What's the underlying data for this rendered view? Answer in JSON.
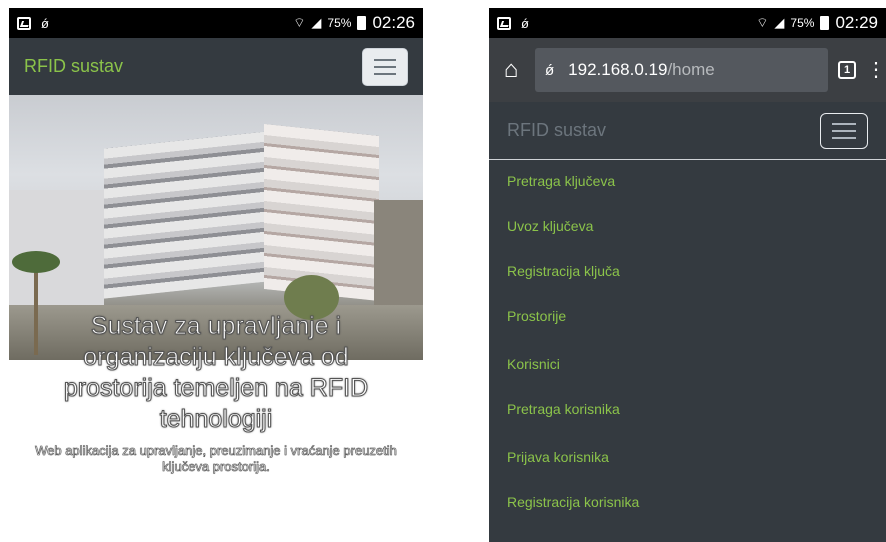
{
  "left_screen": {
    "status_bar": {
      "icons": [
        "gallery-icon",
        "usb-icon",
        "wifi-icon",
        "signal-icon"
      ],
      "battery": "75%",
      "time": "02:26"
    },
    "navbar": {
      "brand": "RFID sustav",
      "toggler_icon": "hamburger-icon"
    },
    "hero": {
      "title": "Sustav za upravljanje i organizaciju ključeva od prostorija temeljen na RFID tehnologiji",
      "subtitle": "Web aplikacija za upravljanje, preuzimanje i vraćanje preuzetih ključeva prostorija."
    }
  },
  "right_screen": {
    "status_bar": {
      "icons": [
        "gallery-icon",
        "usb-icon",
        "wifi-icon",
        "signal-icon"
      ],
      "battery": "75%",
      "time": "02:29"
    },
    "browser": {
      "home_icon": "home-icon",
      "site_icon": "incognito-icon",
      "url_host": "192.168.0.19",
      "url_path": "/home",
      "tab_count": "1",
      "menu_icon": "more-vert-icon"
    },
    "navbar": {
      "brand": "RFID sustav",
      "toggler_icon": "hamburger-icon"
    },
    "menu": [
      "Pretraga ključeva",
      "Uvoz ključeva",
      "Registracija ključa",
      "Prostorije",
      "Korisnici",
      "Pretraga korisnika",
      "Prijava korisnika",
      "Registracija korisnika"
    ]
  },
  "colors": {
    "navbar_bg": "#343a40",
    "brand_green": "#8bc34a",
    "brand_muted": "#6c757d"
  }
}
